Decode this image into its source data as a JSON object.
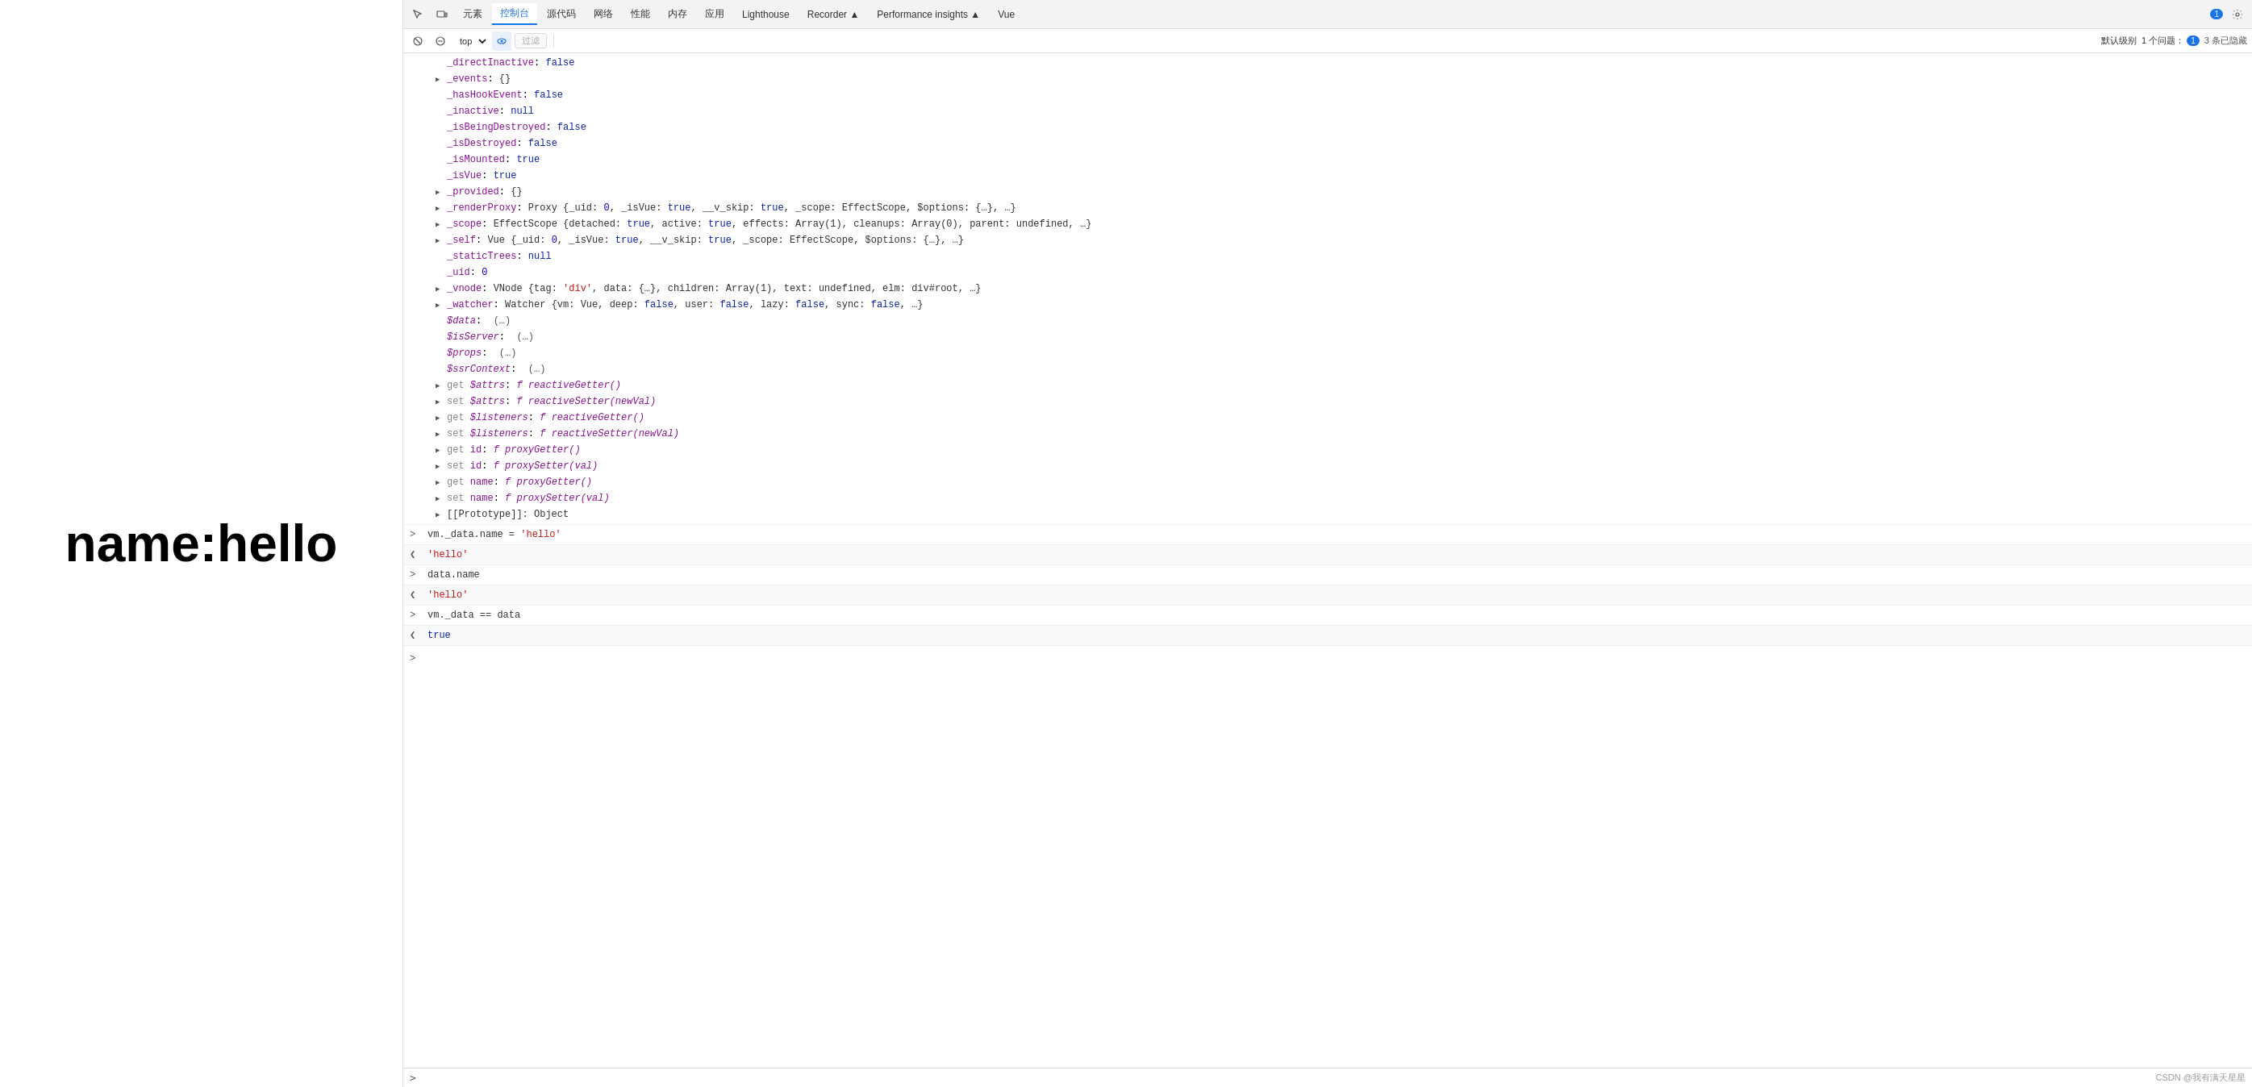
{
  "page": {
    "title": "name:hello"
  },
  "devtools": {
    "nav_tabs": [
      {
        "label": "元素",
        "id": "elements",
        "active": false
      },
      {
        "label": "控制台",
        "id": "console",
        "active": true
      },
      {
        "label": "源代码",
        "id": "sources",
        "active": false
      },
      {
        "label": "网络",
        "id": "network",
        "active": false
      },
      {
        "label": "性能",
        "id": "performance",
        "active": false
      },
      {
        "label": "内存",
        "id": "memory",
        "active": false
      },
      {
        "label": "应用",
        "id": "application",
        "active": false
      },
      {
        "label": "Lighthouse",
        "id": "lighthouse",
        "active": false
      },
      {
        "label": "Recorder ▲",
        "id": "recorder",
        "active": false
      },
      {
        "label": "Performance insights ▲",
        "id": "performance-insights",
        "active": false
      },
      {
        "label": "Vue",
        "id": "vue",
        "active": false
      }
    ],
    "toolbar": {
      "top_label": "top",
      "filter_placeholder": "过滤",
      "level_label": "默认级别",
      "issues_label": "1 个问题：",
      "issues_count": "1",
      "hidden_label": "3 条已隐藏"
    }
  },
  "console_tree": {
    "lines": [
      {
        "indent": 1,
        "triangle": "empty",
        "content": "_directInactive: false",
        "keys": [
          "_directInactive"
        ],
        "sep": ": ",
        "vals": [
          "false"
        ],
        "val_class": "c-bool-false"
      },
      {
        "indent": 1,
        "triangle": "collapsed",
        "content": "_events: {}",
        "keys": [
          "_events"
        ],
        "sep": ": ",
        "vals": [
          "{}"
        ],
        "val_class": "c-obj"
      },
      {
        "indent": 1,
        "triangle": "empty",
        "content": "_hasHookEvent: false",
        "keys": [
          "_hasHookEvent"
        ],
        "sep": ": ",
        "vals": [
          "false"
        ],
        "val_class": "c-bool-false"
      },
      {
        "indent": 1,
        "triangle": "empty",
        "content": "_inactive: null",
        "keys": [
          "_inactive"
        ],
        "sep": ": ",
        "vals": [
          "null"
        ],
        "val_class": "c-null"
      },
      {
        "indent": 1,
        "triangle": "empty",
        "content": "_isBeingDestroyed: false",
        "keys": [
          "_isBeingDestroyed"
        ],
        "sep": ": ",
        "vals": [
          "false"
        ],
        "val_class": "c-bool-false"
      },
      {
        "indent": 1,
        "triangle": "empty",
        "content": "_isDestroyed: false",
        "keys": [
          "_isDestroyed"
        ],
        "sep": ": ",
        "vals": [
          "false"
        ],
        "val_class": "c-bool-false"
      },
      {
        "indent": 1,
        "triangle": "empty",
        "content": "_isMounted: true",
        "keys": [
          "_isMounted"
        ],
        "sep": ": ",
        "vals": [
          "true"
        ],
        "val_class": "c-bool-true"
      },
      {
        "indent": 1,
        "triangle": "empty",
        "content": "_isVue: true",
        "keys": [
          "_isVue"
        ],
        "sep": ": ",
        "vals": [
          "true"
        ],
        "val_class": "c-bool-true"
      },
      {
        "indent": 1,
        "triangle": "collapsed",
        "content": "_provided: {}",
        "keys": [
          "_provided"
        ],
        "sep": ": ",
        "vals": [
          "{}"
        ],
        "val_class": "c-obj"
      },
      {
        "indent": 1,
        "triangle": "collapsed",
        "content": "_renderProxy: Proxy {_uid: 0, _isVue: true, __v_skip: true, _scope: EffectScope, $options: {…}, …}",
        "is_long": true
      },
      {
        "indent": 1,
        "triangle": "collapsed",
        "content": "_scope: EffectScope {detached: true, active: true, effects: Array(1), cleanups: Array(0), parent: undefined, …}",
        "is_long": true
      },
      {
        "indent": 1,
        "triangle": "collapsed",
        "content": "_self: Vue {_uid: 0, _isVue: true, __v_skip: true, _scope: EffectScope, $options: {…}, …}",
        "is_long": true
      },
      {
        "indent": 1,
        "triangle": "empty",
        "content": "_staticTrees: null",
        "keys": [
          "_staticTrees"
        ],
        "sep": ": ",
        "vals": [
          "null"
        ],
        "val_class": "c-null"
      },
      {
        "indent": 1,
        "triangle": "empty",
        "content": "_uid: 0",
        "keys": [
          "_uid"
        ],
        "sep": ": ",
        "vals": [
          "0"
        ],
        "val_class": "c-num"
      },
      {
        "indent": 1,
        "triangle": "collapsed",
        "content": "_vnode: VNode {tag: 'div', data: {…}, children: Array(1), text: undefined, elm: div#root, …}",
        "is_long": true
      },
      {
        "indent": 1,
        "triangle": "collapsed",
        "content": "_watcher: Watcher {vm: Vue, deep: false, user: false, lazy: false, sync: false, …}",
        "is_long": true
      },
      {
        "indent": 1,
        "triangle": "empty",
        "content": "$data:  (…)",
        "keys": [
          "$data"
        ],
        "sep": ":  ",
        "vals": [
          "(…)"
        ],
        "val_class": "c-expand",
        "is_special": true
      },
      {
        "indent": 1,
        "triangle": "empty",
        "content": "$isServer:  (…)",
        "keys": [
          "$isServer"
        ],
        "sep": ":  ",
        "vals": [
          "(…)"
        ],
        "val_class": "c-expand",
        "is_special": true
      },
      {
        "indent": 1,
        "triangle": "empty",
        "content": "$props:  (…)",
        "keys": [
          "$props"
        ],
        "sep": ":  ",
        "vals": [
          "(…)"
        ],
        "val_class": "c-expand",
        "is_special": true
      },
      {
        "indent": 1,
        "triangle": "empty",
        "content": "$ssrContext:  (…)",
        "keys": [
          "$ssrContext"
        ],
        "sep": ":  ",
        "vals": [
          "(…)"
        ],
        "val_class": "c-expand",
        "is_special": true
      },
      {
        "indent": 1,
        "triangle": "collapsed",
        "content": "get $attrs: f reactiveGetter()",
        "prefix": "get ",
        "keys": [
          "$attrs"
        ],
        "sep": ": ",
        "vals": [
          "f reactiveGetter()"
        ],
        "val_class": "c-func"
      },
      {
        "indent": 1,
        "triangle": "collapsed",
        "content": "set $attrs: f reactiveSetter(newVal)",
        "prefix": "set ",
        "keys": [
          "$attrs"
        ],
        "sep": ": ",
        "vals": [
          "f reactiveSetter(newVal)"
        ],
        "val_class": "c-func"
      },
      {
        "indent": 1,
        "triangle": "collapsed",
        "content": "get $listeners: f reactiveGetter()",
        "prefix": "get ",
        "keys": [
          "$listeners"
        ],
        "sep": ": ",
        "vals": [
          "f reactiveGetter()"
        ],
        "val_class": "c-func"
      },
      {
        "indent": 1,
        "triangle": "collapsed",
        "content": "set $listeners: f reactiveSetter(newVal)",
        "prefix": "set ",
        "keys": [
          "$listeners"
        ],
        "sep": ": ",
        "vals": [
          "f reactiveSetter(newVal)"
        ],
        "val_class": "c-func"
      },
      {
        "indent": 1,
        "triangle": "collapsed",
        "content": "get id: f proxyGetter()",
        "prefix": "get ",
        "keys": [
          "id"
        ],
        "sep": ": ",
        "vals": [
          "f proxyGetter()"
        ],
        "val_class": "c-func"
      },
      {
        "indent": 1,
        "triangle": "collapsed",
        "content": "set id: f proxySetter(val)",
        "prefix": "set ",
        "keys": [
          "id"
        ],
        "sep": ": ",
        "vals": [
          "f proxySetter(val)"
        ],
        "val_class": "c-func"
      },
      {
        "indent": 1,
        "triangle": "collapsed",
        "content": "get name: f proxyGetter()",
        "prefix": "get ",
        "keys": [
          "name"
        ],
        "sep": ": ",
        "vals": [
          "f proxyGetter()"
        ],
        "val_class": "c-func"
      },
      {
        "indent": 1,
        "triangle": "collapsed",
        "content": "set name: f proxySetter(val)",
        "prefix": "set ",
        "keys": [
          "name"
        ],
        "sep": ": ",
        "vals": [
          "f proxySetter(val)"
        ],
        "val_class": "c-func"
      },
      {
        "indent": 1,
        "triangle": "collapsed",
        "content": "▶[[Prototype]]: Object",
        "is_proto": true
      }
    ]
  },
  "console_interactions": [
    {
      "type": "input",
      "prompt": ">",
      "text": "vm._data.name = 'hello'"
    },
    {
      "type": "output",
      "prompt": "<",
      "text": "'hello'",
      "class": "c-string"
    },
    {
      "type": "input",
      "prompt": ">",
      "text": "data.name"
    },
    {
      "type": "output",
      "prompt": "<",
      "text": "'hello'",
      "class": "c-string"
    },
    {
      "type": "input",
      "prompt": ">",
      "text": "vm._data == data"
    },
    {
      "type": "output",
      "prompt": "<",
      "text": "true",
      "class": "c-bool-true"
    }
  ],
  "watermark": "CSDN @我有满天星星"
}
